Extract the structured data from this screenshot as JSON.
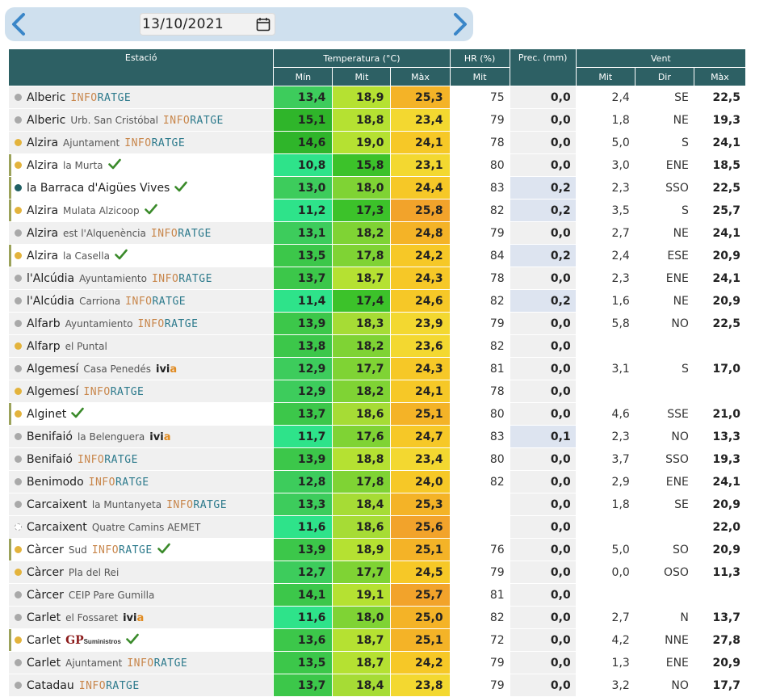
{
  "date": "13/10/2021",
  "nav": {
    "prev_icon": "chevron-left-icon",
    "next_icon": "chevron-right-icon",
    "calendar_icon": "calendar-icon"
  },
  "headers": {
    "station": "Estació",
    "temperature": "Temperatura (°C)",
    "humidity": "HR (%)",
    "precip": "Prec. (mm)",
    "wind": "Vent",
    "t_min": "Mín",
    "t_avg": "Mit",
    "t_max": "Màx",
    "hr_avg": "Mit",
    "w_avg": "Mit",
    "w_dir": "Dir",
    "w_max": "Màx"
  },
  "colors": {
    "header": "#2d6064",
    "dot_grey": "#a9a9a9",
    "dot_yellow": "#e3b33c",
    "dot_teal": "#1f5f63",
    "check": "#3a8a2a",
    "precip_wet": "#dde4f0"
  },
  "rows": [
    {
      "name": "Alberic",
      "sub": "",
      "logo": "inforatge",
      "check": false,
      "dot": "grey",
      "hl": false,
      "tmin": "13,4",
      "tavg": "18,9",
      "tmax": "25,3",
      "hr": "75",
      "prec": "0,0",
      "wavg": "2,4",
      "wdir": "SE",
      "wmax": "22,5"
    },
    {
      "name": "Alberic",
      "sub": "Urb. San Cristóbal",
      "logo": "inforatge",
      "check": false,
      "dot": "grey",
      "hl": false,
      "tmin": "15,1",
      "tavg": "18,8",
      "tmax": "23,4",
      "hr": "79",
      "prec": "0,0",
      "wavg": "1,8",
      "wdir": "NE",
      "wmax": "19,3"
    },
    {
      "name": "Alzira",
      "sub": "Ajuntament",
      "logo": "inforatge",
      "check": false,
      "dot": "yellow",
      "hl": false,
      "tmin": "14,6",
      "tavg": "19,0",
      "tmax": "24,1",
      "hr": "78",
      "prec": "0,0",
      "wavg": "5,0",
      "wdir": "S",
      "wmax": "24,1"
    },
    {
      "name": "Alzira",
      "sub": "la Murta",
      "logo": "",
      "check": true,
      "dot": "yellow",
      "hl": true,
      "tmin": "10,8",
      "tavg": "15,8",
      "tmax": "23,1",
      "hr": "80",
      "prec": "0,0",
      "wavg": "3,0",
      "wdir": "ENE",
      "wmax": "18,5"
    },
    {
      "name": "la Barraca d'Aigües Vives",
      "sub": "",
      "logo": "",
      "check": true,
      "dot": "teal",
      "hl": true,
      "tmin": "13,0",
      "tavg": "18,0",
      "tmax": "24,4",
      "hr": "83",
      "prec": "0,2",
      "wavg": "2,3",
      "wdir": "SSO",
      "wmax": "22,5"
    },
    {
      "name": "Alzira",
      "sub": "Mulata Alzicoop",
      "logo": "",
      "check": true,
      "dot": "yellow",
      "hl": true,
      "tmin": "11,2",
      "tavg": "17,3",
      "tmax": "25,8",
      "hr": "82",
      "prec": "0,2",
      "wavg": "3,5",
      "wdir": "S",
      "wmax": "25,7"
    },
    {
      "name": "Alzira",
      "sub": "est l'Alquenència",
      "logo": "inforatge",
      "check": false,
      "dot": "grey",
      "hl": false,
      "tmin": "13,1",
      "tavg": "18,2",
      "tmax": "24,8",
      "hr": "79",
      "prec": "0,0",
      "wavg": "2,7",
      "wdir": "NE",
      "wmax": "24,1"
    },
    {
      "name": "Alzira",
      "sub": "la Casella",
      "logo": "",
      "check": true,
      "dot": "yellow",
      "hl": true,
      "tmin": "13,5",
      "tavg": "17,8",
      "tmax": "24,2",
      "hr": "84",
      "prec": "0,2",
      "wavg": "2,4",
      "wdir": "ESE",
      "wmax": "20,9"
    },
    {
      "name": "l'Alcúdia",
      "sub": "Ayuntamiento",
      "logo": "inforatge",
      "check": false,
      "dot": "grey",
      "hl": false,
      "tmin": "13,7",
      "tavg": "18,7",
      "tmax": "24,3",
      "hr": "78",
      "prec": "0,0",
      "wavg": "2,3",
      "wdir": "ENE",
      "wmax": "24,1"
    },
    {
      "name": "l'Alcúdia",
      "sub": "Carriona",
      "logo": "inforatge",
      "check": false,
      "dot": "grey",
      "hl": false,
      "tmin": "11,4",
      "tavg": "17,4",
      "tmax": "24,6",
      "hr": "82",
      "prec": "0,2",
      "wavg": "1,6",
      "wdir": "NE",
      "wmax": "20,9"
    },
    {
      "name": "Alfarb",
      "sub": "Ayuntamiento",
      "logo": "inforatge",
      "check": false,
      "dot": "grey",
      "hl": false,
      "tmin": "13,9",
      "tavg": "18,3",
      "tmax": "23,9",
      "hr": "79",
      "prec": "0,0",
      "wavg": "5,8",
      "wdir": "NO",
      "wmax": "22,5"
    },
    {
      "name": "Alfarp",
      "sub": "el Puntal",
      "logo": "",
      "check": false,
      "dot": "yellow",
      "hl": false,
      "tmin": "13,8",
      "tavg": "18,2",
      "tmax": "23,6",
      "hr": "82",
      "prec": "0,0",
      "wavg": "",
      "wdir": "",
      "wmax": ""
    },
    {
      "name": "Algemesí",
      "sub": "Casa Penedés",
      "logo": "ivia",
      "check": false,
      "dot": "grey",
      "hl": false,
      "tmin": "12,9",
      "tavg": "17,7",
      "tmax": "24,3",
      "hr": "81",
      "prec": "0,0",
      "wavg": "3,1",
      "wdir": "S",
      "wmax": "17,0"
    },
    {
      "name": "Algemesí",
      "sub": "",
      "logo": "inforatge",
      "check": false,
      "dot": "yellow",
      "hl": false,
      "tmin": "12,9",
      "tavg": "18,2",
      "tmax": "24,1",
      "hr": "78",
      "prec": "0,0",
      "wavg": "",
      "wdir": "",
      "wmax": ""
    },
    {
      "name": "Alginet",
      "sub": "",
      "logo": "",
      "check": true,
      "dot": "yellow",
      "hl": true,
      "tmin": "13,7",
      "tavg": "18,6",
      "tmax": "25,1",
      "hr": "80",
      "prec": "0,0",
      "wavg": "4,6",
      "wdir": "SSE",
      "wmax": "21,0"
    },
    {
      "name": "Benifaió",
      "sub": "la Belenguera",
      "logo": "ivia",
      "check": false,
      "dot": "grey",
      "hl": false,
      "tmin": "11,7",
      "tavg": "17,6",
      "tmax": "24,7",
      "hr": "83",
      "prec": "0,1",
      "wavg": "2,3",
      "wdir": "NO",
      "wmax": "13,3"
    },
    {
      "name": "Benifaió",
      "sub": "",
      "logo": "inforatge",
      "check": false,
      "dot": "grey",
      "hl": false,
      "tmin": "13,9",
      "tavg": "18,8",
      "tmax": "23,4",
      "hr": "80",
      "prec": "0,0",
      "wavg": "3,7",
      "wdir": "SSO",
      "wmax": "19,3"
    },
    {
      "name": "Benimodo",
      "sub": "",
      "logo": "inforatge",
      "check": false,
      "dot": "grey",
      "hl": false,
      "tmin": "12,8",
      "tavg": "17,8",
      "tmax": "24,0",
      "hr": "82",
      "prec": "0,0",
      "wavg": "2,9",
      "wdir": "ENE",
      "wmax": "24,1"
    },
    {
      "name": "Carcaixent",
      "sub": "la Muntanyeta",
      "logo": "inforatge",
      "check": false,
      "dot": "grey",
      "hl": false,
      "tmin": "13,3",
      "tavg": "18,4",
      "tmax": "25,3",
      "hr": "",
      "prec": "0,0",
      "wavg": "1,8",
      "wdir": "SE",
      "wmax": "20,9"
    },
    {
      "name": "Carcaixent",
      "sub": "Quatre Camins AEMET",
      "logo": "",
      "check": false,
      "dot": "dashed",
      "hl": false,
      "tmin": "11,6",
      "tavg": "18,6",
      "tmax": "25,6",
      "hr": "",
      "prec": "0,0",
      "wavg": "",
      "wdir": "",
      "wmax": "22,0"
    },
    {
      "name": "Càrcer",
      "sub": "Sud",
      "logo": "inforatge",
      "check": true,
      "dot": "yellow",
      "hl": true,
      "tmin": "13,9",
      "tavg": "18,9",
      "tmax": "25,1",
      "hr": "76",
      "prec": "0,0",
      "wavg": "5,0",
      "wdir": "SO",
      "wmax": "20,9"
    },
    {
      "name": "Càrcer",
      "sub": "Pla del Rei",
      "logo": "",
      "check": false,
      "dot": "yellow",
      "hl": false,
      "tmin": "12,7",
      "tavg": "17,7",
      "tmax": "24,5",
      "hr": "79",
      "prec": "0,0",
      "wavg": "0,0",
      "wdir": "OSO",
      "wmax": "11,3"
    },
    {
      "name": "Càrcer",
      "sub": "CEIP Pare Gumilla",
      "logo": "",
      "check": false,
      "dot": "grey",
      "hl": false,
      "tmin": "14,1",
      "tavg": "19,1",
      "tmax": "25,7",
      "hr": "81",
      "prec": "0,0",
      "wavg": "",
      "wdir": "",
      "wmax": ""
    },
    {
      "name": "Carlet",
      "sub": "el Fossaret",
      "logo": "ivia",
      "check": false,
      "dot": "grey",
      "hl": false,
      "tmin": "11,6",
      "tavg": "18,0",
      "tmax": "25,0",
      "hr": "82",
      "prec": "0,0",
      "wavg": "2,7",
      "wdir": "N",
      "wmax": "13,7"
    },
    {
      "name": "Carlet",
      "sub": "",
      "logo": "gp",
      "check": true,
      "dot": "yellow",
      "hl": true,
      "tmin": "13,6",
      "tavg": "18,7",
      "tmax": "25,1",
      "hr": "72",
      "prec": "0,0",
      "wavg": "4,2",
      "wdir": "NNE",
      "wmax": "27,8"
    },
    {
      "name": "Carlet",
      "sub": "Ajuntament",
      "logo": "inforatge",
      "check": false,
      "dot": "grey",
      "hl": false,
      "tmin": "13,5",
      "tavg": "18,7",
      "tmax": "24,2",
      "hr": "79",
      "prec": "0,0",
      "wavg": "1,3",
      "wdir": "ENE",
      "wmax": "20,9"
    },
    {
      "name": "Catadau",
      "sub": "",
      "logo": "inforatge",
      "check": false,
      "dot": "grey",
      "hl": false,
      "tmin": "13,7",
      "tavg": "18,4",
      "tmax": "23,8",
      "hr": "79",
      "prec": "0,0",
      "wavg": "3,2",
      "wdir": "NO",
      "wmax": "17,7"
    }
  ],
  "logos": {
    "inforatge_a": "INFO",
    "inforatge_b": "RATGE",
    "ivia_a": "ivi",
    "ivia_b": "a",
    "gp_a": "GP",
    "gp_b": "Suministros"
  }
}
